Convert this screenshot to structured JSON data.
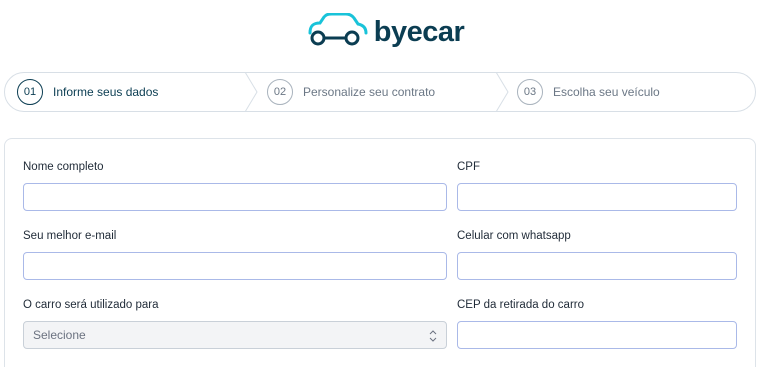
{
  "brand": {
    "name": "byecar",
    "logo_icon": "car-outline-icon",
    "color": "#0b3d52",
    "accent": "#19c3d9"
  },
  "steps": [
    {
      "number": "01",
      "label": "Informe seus dados",
      "active": true
    },
    {
      "number": "02",
      "label": "Personalize seu contrato",
      "active": false
    },
    {
      "number": "03",
      "label": "Escolha seu veículo",
      "active": false
    }
  ],
  "form": {
    "full_name": {
      "label": "Nome completo",
      "value": ""
    },
    "cpf": {
      "label": "CPF",
      "value": ""
    },
    "email": {
      "label": "Seu melhor e-mail",
      "value": ""
    },
    "phone": {
      "label": "Celular com whatsapp",
      "value": ""
    },
    "usage": {
      "label": "O carro será utilizado para",
      "selected": "Selecione"
    },
    "cep": {
      "label": "CEP da retirada do carro",
      "value": ""
    }
  }
}
